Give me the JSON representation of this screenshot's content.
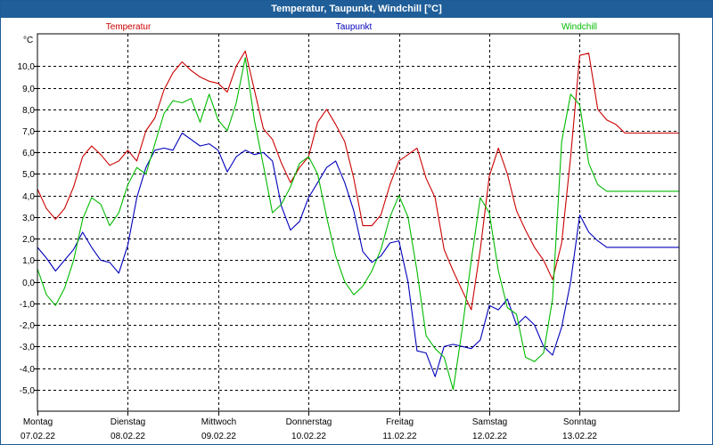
{
  "chart_data": {
    "type": "line",
    "title": "Temperatur, Taupunkt, Windchill [°C]",
    "ylabel": "°C",
    "ylim": [
      -6,
      11.5
    ],
    "yticks": [
      10.0,
      9.0,
      8.0,
      7.0,
      6.0,
      5.0,
      4.0,
      3.0,
      2.0,
      1.0,
      0.0,
      -1.0,
      -2.0,
      -3.0,
      -4.0,
      -5.0
    ],
    "ytick_labels": [
      "10,0",
      "9,0",
      "8,0",
      "7,0",
      "6,0",
      "5,0",
      "4,0",
      "3,0",
      "2,0",
      "1,0",
      "0,0",
      "-1,0",
      "-2,0",
      "-3,0",
      "-4,0",
      "-5,0"
    ],
    "xlim": [
      0,
      7.1
    ],
    "grid": true,
    "days": [
      {
        "weekday": "Montag",
        "date": "07.02.22"
      },
      {
        "weekday": "Dienstag",
        "date": "08.02.22"
      },
      {
        "weekday": "Mittwoch",
        "date": "09.02.22"
      },
      {
        "weekday": "Donnerstag",
        "date": "10.02.22"
      },
      {
        "weekday": "Freitag",
        "date": "11.02.22"
      },
      {
        "weekday": "Samstag",
        "date": "12.02.22"
      },
      {
        "weekday": "Sonntag",
        "date": "13.02.22"
      }
    ],
    "series": [
      {
        "name": "Temperatur",
        "color": "#cc0000",
        "x": [
          0,
          0.1,
          0.2,
          0.3,
          0.4,
          0.5,
          0.6,
          0.7,
          0.8,
          0.9,
          1.0,
          1.1,
          1.2,
          1.3,
          1.4,
          1.5,
          1.6,
          1.7,
          1.8,
          1.9,
          2.0,
          2.1,
          2.2,
          2.3,
          2.4,
          2.5,
          2.6,
          2.7,
          2.8,
          2.9,
          3.0,
          3.1,
          3.2,
          3.3,
          3.4,
          3.5,
          3.6,
          3.7,
          3.8,
          3.9,
          4.0,
          4.1,
          4.2,
          4.3,
          4.4,
          4.5,
          4.6,
          4.7,
          4.8,
          4.9,
          5.0,
          5.1,
          5.2,
          5.3,
          5.4,
          5.5,
          5.6,
          5.7,
          5.8,
          5.9,
          6.0,
          6.1,
          6.2,
          6.3,
          6.4,
          6.5,
          6.6,
          6.7,
          6.8,
          6.9,
          7.0,
          7.1
        ],
        "values": [
          4.3,
          3.4,
          2.9,
          3.4,
          4.4,
          5.8,
          6.3,
          5.9,
          5.4,
          5.6,
          6.1,
          5.6,
          7.0,
          7.6,
          8.9,
          9.7,
          10.2,
          9.8,
          9.5,
          9.3,
          9.2,
          8.8,
          10.0,
          10.7,
          8.9,
          7.1,
          6.6,
          5.5,
          4.6,
          5.3,
          5.8,
          7.4,
          8.0,
          7.3,
          6.5,
          4.8,
          2.6,
          2.6,
          3.1,
          4.5,
          5.6,
          5.9,
          6.2,
          4.8,
          3.9,
          1.5,
          0.5,
          -0.4,
          -1.3,
          1.5,
          4.9,
          6.2,
          5.0,
          3.3,
          2.4,
          1.6,
          1.0,
          0.1,
          1.8,
          5.8,
          10.5,
          10.6,
          8.0,
          7.5,
          7.3,
          6.9,
          6.9,
          6.9,
          6.9,
          6.9,
          6.9,
          6.9
        ]
      },
      {
        "name": "Taupunkt",
        "color": "#0000bb",
        "x": [
          0,
          0.1,
          0.2,
          0.3,
          0.4,
          0.5,
          0.6,
          0.7,
          0.8,
          0.9,
          1.0,
          1.1,
          1.2,
          1.3,
          1.4,
          1.5,
          1.6,
          1.7,
          1.8,
          1.9,
          2.0,
          2.1,
          2.2,
          2.3,
          2.4,
          2.5,
          2.6,
          2.7,
          2.8,
          2.9,
          3.0,
          3.1,
          3.2,
          3.3,
          3.4,
          3.5,
          3.6,
          3.7,
          3.8,
          3.9,
          4.0,
          4.1,
          4.2,
          4.3,
          4.4,
          4.5,
          4.6,
          4.7,
          4.8,
          4.9,
          5.0,
          5.1,
          5.2,
          5.3,
          5.4,
          5.5,
          5.6,
          5.7,
          5.8,
          5.9,
          6.0,
          6.1,
          6.2,
          6.3,
          6.4,
          6.5,
          6.6,
          6.7,
          6.8,
          6.9,
          7.0,
          7.1
        ],
        "values": [
          1.6,
          1.1,
          0.5,
          1.0,
          1.5,
          2.3,
          1.6,
          1.0,
          0.9,
          0.4,
          1.7,
          3.9,
          5.3,
          6.1,
          6.2,
          6.1,
          6.9,
          6.6,
          6.3,
          6.4,
          6.1,
          5.1,
          5.8,
          6.1,
          5.9,
          6.0,
          5.6,
          3.5,
          2.4,
          2.8,
          3.9,
          4.6,
          5.3,
          5.6,
          4.6,
          3.3,
          1.4,
          0.9,
          1.2,
          1.8,
          1.9,
          0.0,
          -3.2,
          -3.3,
          -4.4,
          -3.0,
          -2.9,
          -3.0,
          -3.1,
          -2.7,
          -1.1,
          -1.3,
          -0.8,
          -2.0,
          -1.6,
          -2.0,
          -3.0,
          -3.4,
          -2.1,
          0.0,
          3.1,
          2.3,
          1.9,
          1.6,
          1.6,
          1.6,
          1.6,
          1.6,
          1.6,
          1.6,
          1.6,
          1.6
        ]
      },
      {
        "name": "Windchill",
        "color": "#00bb00",
        "x": [
          0,
          0.1,
          0.2,
          0.3,
          0.4,
          0.5,
          0.6,
          0.7,
          0.8,
          0.9,
          1.0,
          1.1,
          1.2,
          1.3,
          1.4,
          1.5,
          1.6,
          1.7,
          1.8,
          1.9,
          2.0,
          2.1,
          2.2,
          2.3,
          2.4,
          2.5,
          2.6,
          2.7,
          2.8,
          2.9,
          3.0,
          3.1,
          3.2,
          3.3,
          3.4,
          3.5,
          3.6,
          3.7,
          3.8,
          3.9,
          4.0,
          4.1,
          4.2,
          4.3,
          4.4,
          4.5,
          4.6,
          4.7,
          4.8,
          4.9,
          5.0,
          5.1,
          5.2,
          5.3,
          5.4,
          5.5,
          5.6,
          5.7,
          5.8,
          5.9,
          6.0,
          6.1,
          6.2,
          6.3,
          6.4,
          6.5,
          6.6,
          6.7,
          6.8,
          6.9,
          7.0,
          7.1
        ],
        "values": [
          0.6,
          -0.6,
          -1.1,
          -0.3,
          1.0,
          2.9,
          3.9,
          3.6,
          2.6,
          3.2,
          4.5,
          5.3,
          5.0,
          6.4,
          7.8,
          8.4,
          8.3,
          8.5,
          7.4,
          8.7,
          7.5,
          7.0,
          8.3,
          10.4,
          7.5,
          5.4,
          3.2,
          3.6,
          4.4,
          5.5,
          5.8,
          5.0,
          3.0,
          1.2,
          0.0,
          -0.6,
          -0.2,
          0.5,
          1.5,
          3.0,
          4.0,
          3.0,
          0.5,
          -2.5,
          -3.1,
          -3.5,
          -5.0,
          -2.2,
          1.0,
          3.9,
          3.2,
          0.5,
          -1.2,
          -1.5,
          -3.5,
          -3.7,
          -3.3,
          -0.8,
          6.5,
          8.7,
          8.2,
          5.5,
          4.5,
          4.2,
          4.2,
          4.2,
          4.2,
          4.2,
          4.2,
          4.2,
          4.2,
          4.2
        ]
      }
    ]
  }
}
